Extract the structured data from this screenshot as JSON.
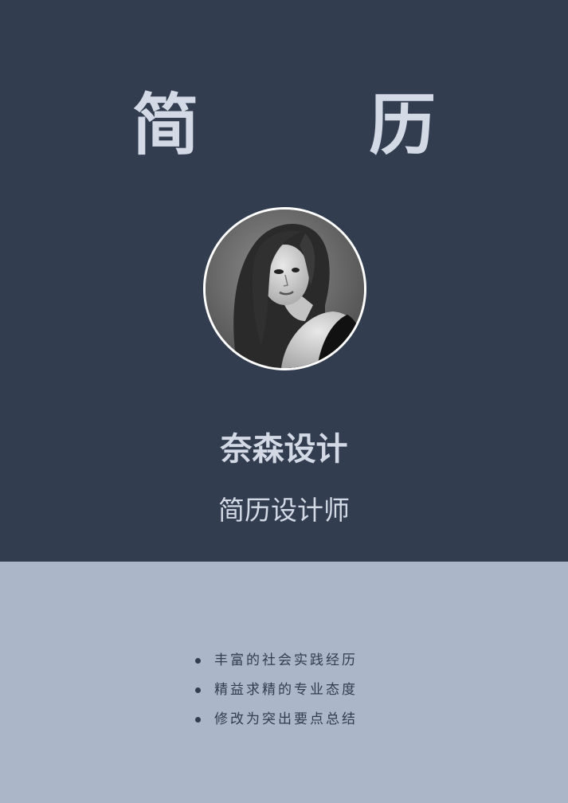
{
  "header": {
    "title": "简 历",
    "name": "奈森设计",
    "role": "简历设计师"
  },
  "avatar": {
    "icon": "portrait-photo"
  },
  "highlights": [
    "丰富的社会实践经历",
    "精益求精的专业态度",
    "修改为突出要点总结"
  ],
  "colors": {
    "top_background": "#323d4f",
    "bottom_background": "#abb6c8",
    "title_text": "#d3dae6",
    "bullet_text": "#323d4f"
  }
}
